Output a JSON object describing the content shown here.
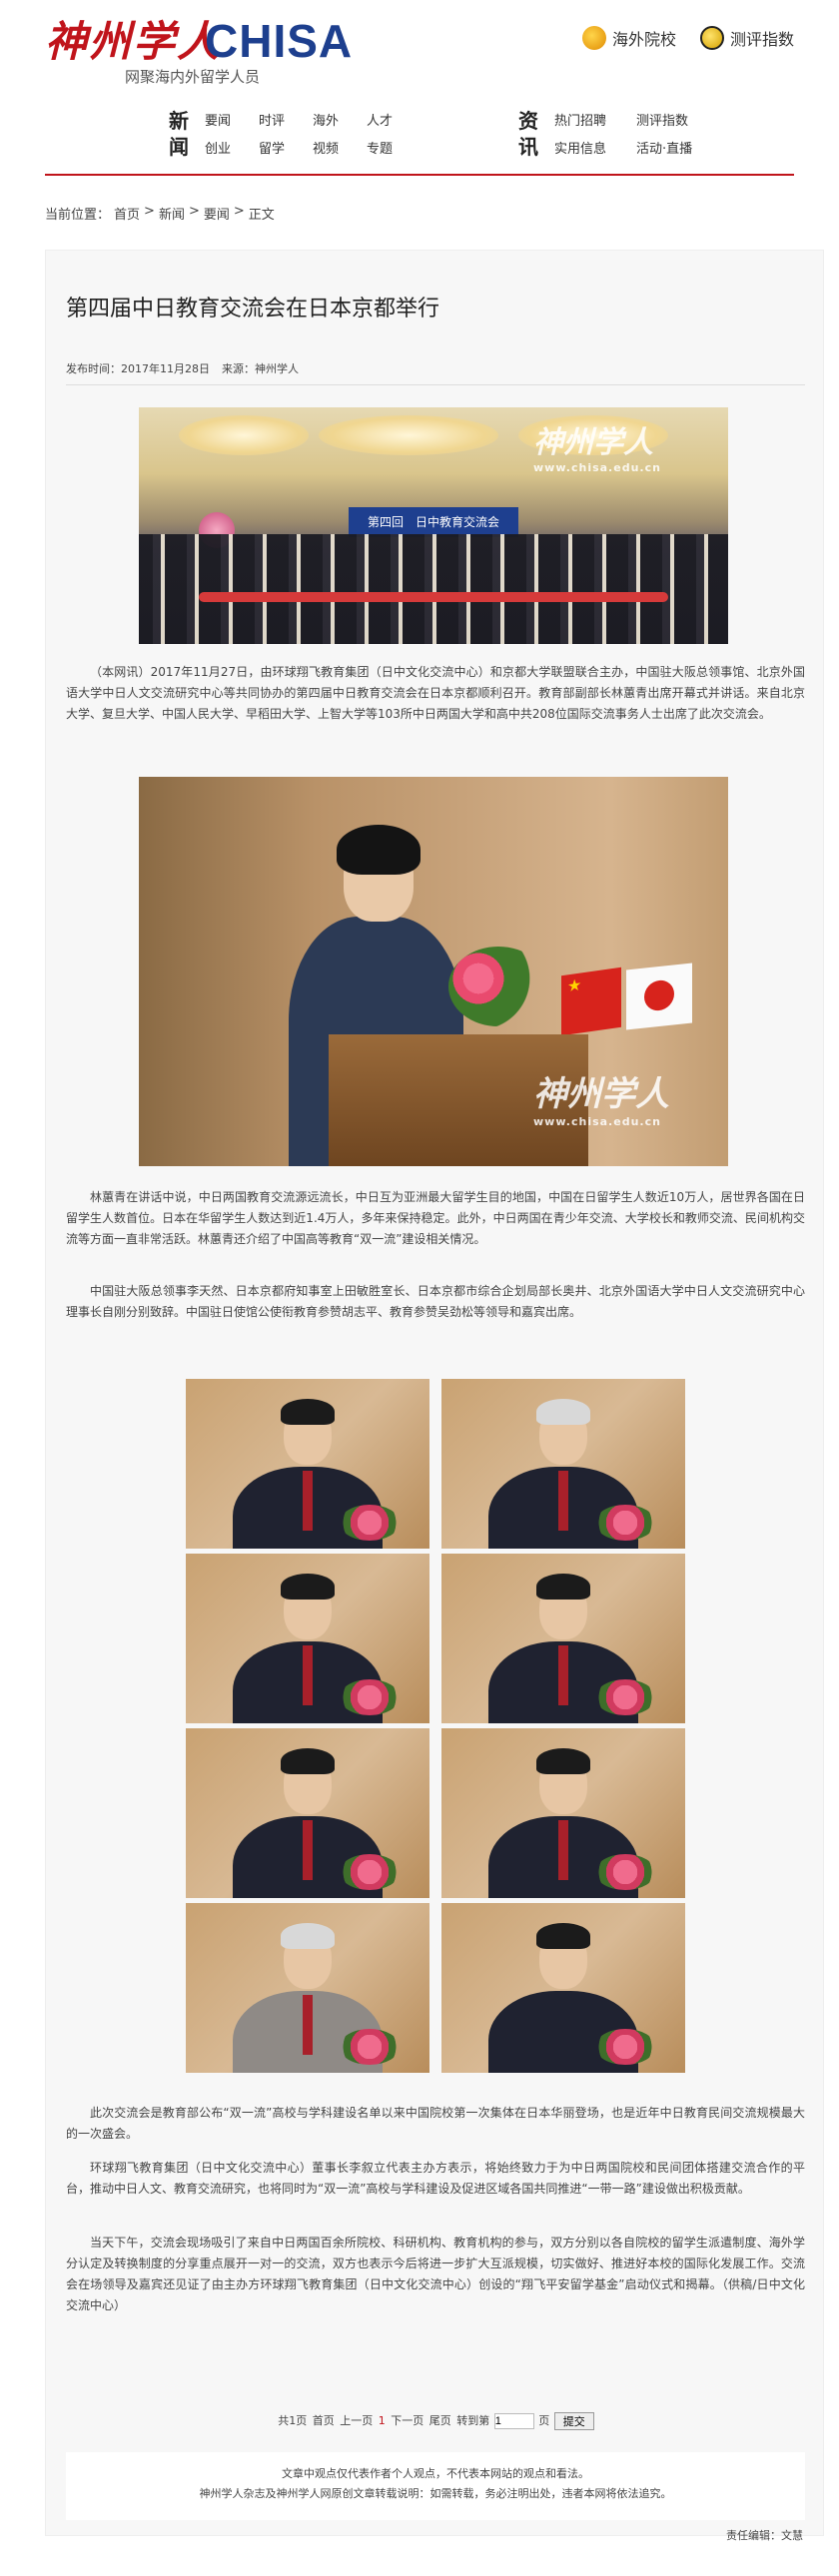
{
  "brand": {
    "logo_cn": "神州学人",
    "logo_en": "CHISA",
    "slogan": "网聚海内外留学人员"
  },
  "toplinks": [
    {
      "label": "海外院校",
      "icon": "school-emblem-icon"
    },
    {
      "label": "测评指数",
      "icon": "ranking-index-icon"
    }
  ],
  "nav": {
    "news": {
      "title_a": "新",
      "title_b": "闻",
      "items": [
        "要闻",
        "创业",
        "时评",
        "留学",
        "海外",
        "视频",
        "人才",
        "专题"
      ]
    },
    "info": {
      "title_a": "资",
      "title_b": "讯",
      "items": [
        "热门招聘",
        "实用信息",
        "测评指数",
        "活动·直播"
      ]
    }
  },
  "breadcrumb": {
    "prefix": "当前位置：",
    "items": [
      "首页",
      "新闻",
      "要闻",
      "正文"
    ],
    "sep": ">"
  },
  "article": {
    "title": "第四届中日教育交流会在日本京都举行",
    "publish_time": "发布时间：2017年11月28日",
    "source": "来源：神州学人",
    "banner_text": "第四回　日中教育交流会",
    "watermark_cn": "神州学人",
    "watermark_url": "www.chisa.edu.cn",
    "paragraphs": [
      "（本网讯）2017年11月27日，由环球翔飞教育集团（日中文化交流中心）和京都大学联盟联合主办，中国驻大阪总领事馆、北京外国语大学中日人文交流研究中心等共同协办的第四届中日教育交流会在日本京都顺利召开。教育部副部长林蕙青出席开幕式并讲话。来自北京大学、复旦大学、中国人民大学、早稻田大学、上智大学等103所中日两国大学和高中共208位国际交流事务人士出席了此次交流会。",
      "林蕙青在讲话中说，中日两国教育交流源远流长，中日互为亚洲最大留学生目的地国，中国在日留学生人数近10万人，居世界各国在日留学生人数首位。日本在华留学生人数达到近1.4万人，多年来保持稳定。此外，中日两国在青少年交流、大学校长和教师交流、民间机构交流等方面一直非常活跃。林蕙青还介绍了中国高等教育“双一流”建设相关情况。",
      "中国驻大阪总领事李天然、日本京都府知事室上田敏胜室长、日本京都市综合企划局部长奥井、北京外国语大学中日人文交流研究中心理事长自刚分别致辞。中国驻日使馆公使衔教育参赞胡志平、教育参赞吴劲松等领导和嘉宾出席。",
      "此次交流会是教育部公布“双一流”高校与学科建设名单以来中国院校第一次集体在日本华丽登场，也是近年中日教育民间交流规模最大的一次盛会。",
      "环球翔飞教育集团（日中文化交流中心）董事长李叙立代表主办方表示，将始终致力于为中日两国院校和民间团体搭建交流合作的平台，推动中日人文、教育交流研究，也将同时为“双一流”高校与学科建设及促进区域各国共同推进“一带一路”建设做出积极贡献。",
      "当天下午，交流会现场吸引了来自中日两国百余所院校、科研机构、教育机构的参与，双方分别以各自院校的留学生派遣制度、海外学分认定及转换制度的分享重点展开一对一的交流，双方也表示今后将进一步扩大互派规模，切实做好、推进好本校的国际化发展工作。交流会在场领导及嘉宾还见证了由主办方环球翔飞教育集团（日中文化交流中心）创设的“翔飞平安留学基金”启动仪式和揭幕。（供稿/日中文化交流中心）"
    ]
  },
  "pager": {
    "total": "共1页",
    "first": "首页",
    "prev": "上一页",
    "current": "1",
    "next": "下一页",
    "last": "尾页",
    "goto": "转到第",
    "page_input": "1",
    "page_unit": "页",
    "submit": "提交"
  },
  "notice": {
    "line1": "文章中观点仅代表作者个人观点，不代表本网站的观点和看法。",
    "line2": "神州学人杂志及神州学人网原创文章转载说明：如需转载，务必注明出处，违者本网将依法追究。"
  },
  "editor": "责任编辑：文慧"
}
